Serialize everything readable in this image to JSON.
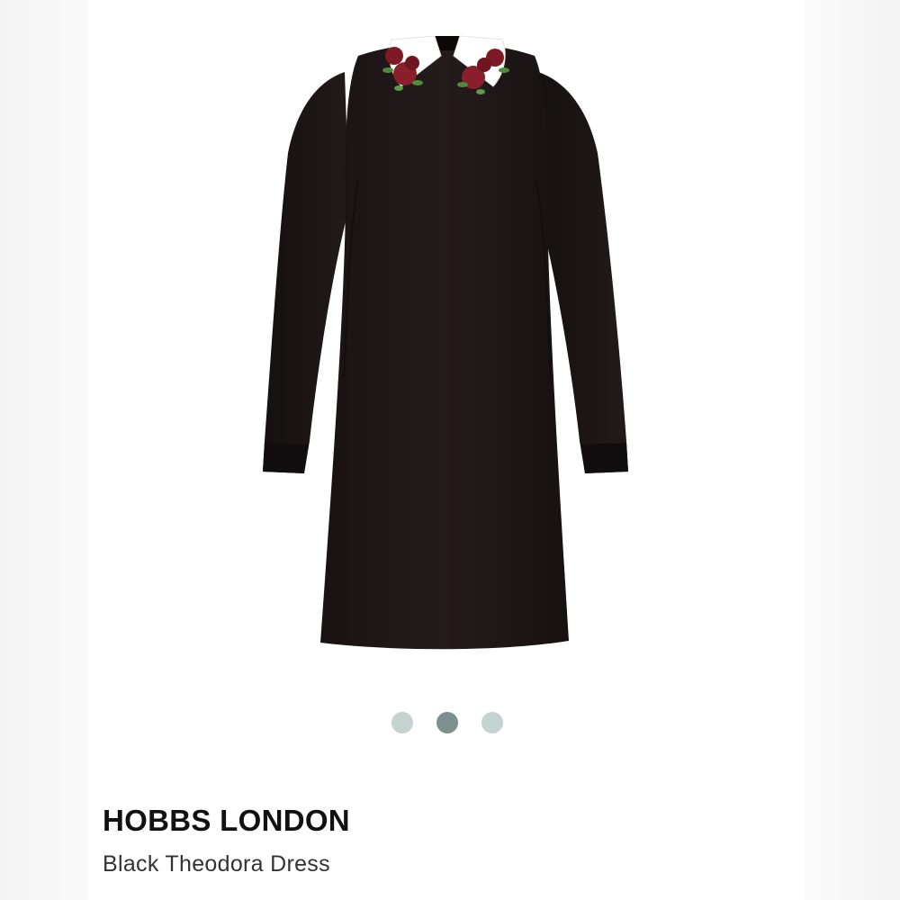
{
  "product": {
    "brand": "HOBBS LONDON",
    "name": "Black Theodora Dress",
    "image": {
      "subject": "dress-photo",
      "dress_color": "#1f1718",
      "collar_color": "#ffffff",
      "rose_color": "#8a1f2c",
      "leaf_color": "#4f8a3a"
    }
  },
  "carousel": {
    "slide_count": 3,
    "active_index": 1,
    "dot_color": "#c4d2d0",
    "active_dot_color": "#7c918f"
  }
}
